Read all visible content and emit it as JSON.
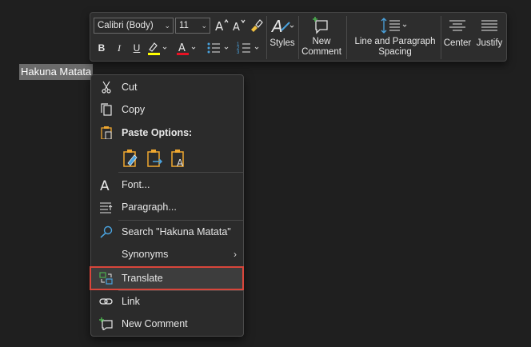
{
  "document": {
    "selected_text": "Hakuna Matata"
  },
  "mini_toolbar": {
    "font_name": "Calibri (Body)",
    "font_size": "11",
    "bold_label": "B",
    "italic_label": "I",
    "underline_label": "U",
    "styles_label": "Styles",
    "new_comment_label_line1": "New",
    "new_comment_label_line2": "Comment",
    "line_spacing_label_line1": "Line and Paragraph",
    "line_spacing_label_line2": "Spacing",
    "center_label": "Center",
    "justify_label": "Justify",
    "highlight_color": "#ffff00",
    "font_color": "#e81123"
  },
  "context_menu": {
    "cut": "Cut",
    "copy": "Copy",
    "paste_options": "Paste Options:",
    "font": "Font...",
    "paragraph": "Paragraph...",
    "search": "Search \"Hakuna Matata\"",
    "synonyms": "Synonyms",
    "translate": "Translate",
    "link": "Link",
    "new_comment": "New Comment"
  },
  "icons": {
    "cut": "scissors-icon",
    "copy": "copy-icon",
    "paste": "clipboard-icon",
    "font": "font-icon",
    "paragraph": "paragraph-icon",
    "search": "search-icon",
    "translate": "translate-icon",
    "link": "link-icon",
    "new_comment": "new-comment-icon"
  },
  "colors": {
    "highlight_outline": "#d9463b",
    "accent_green": "#4caf50",
    "paste_orange": "#f0a830",
    "link_blue": "#4aa3df"
  }
}
